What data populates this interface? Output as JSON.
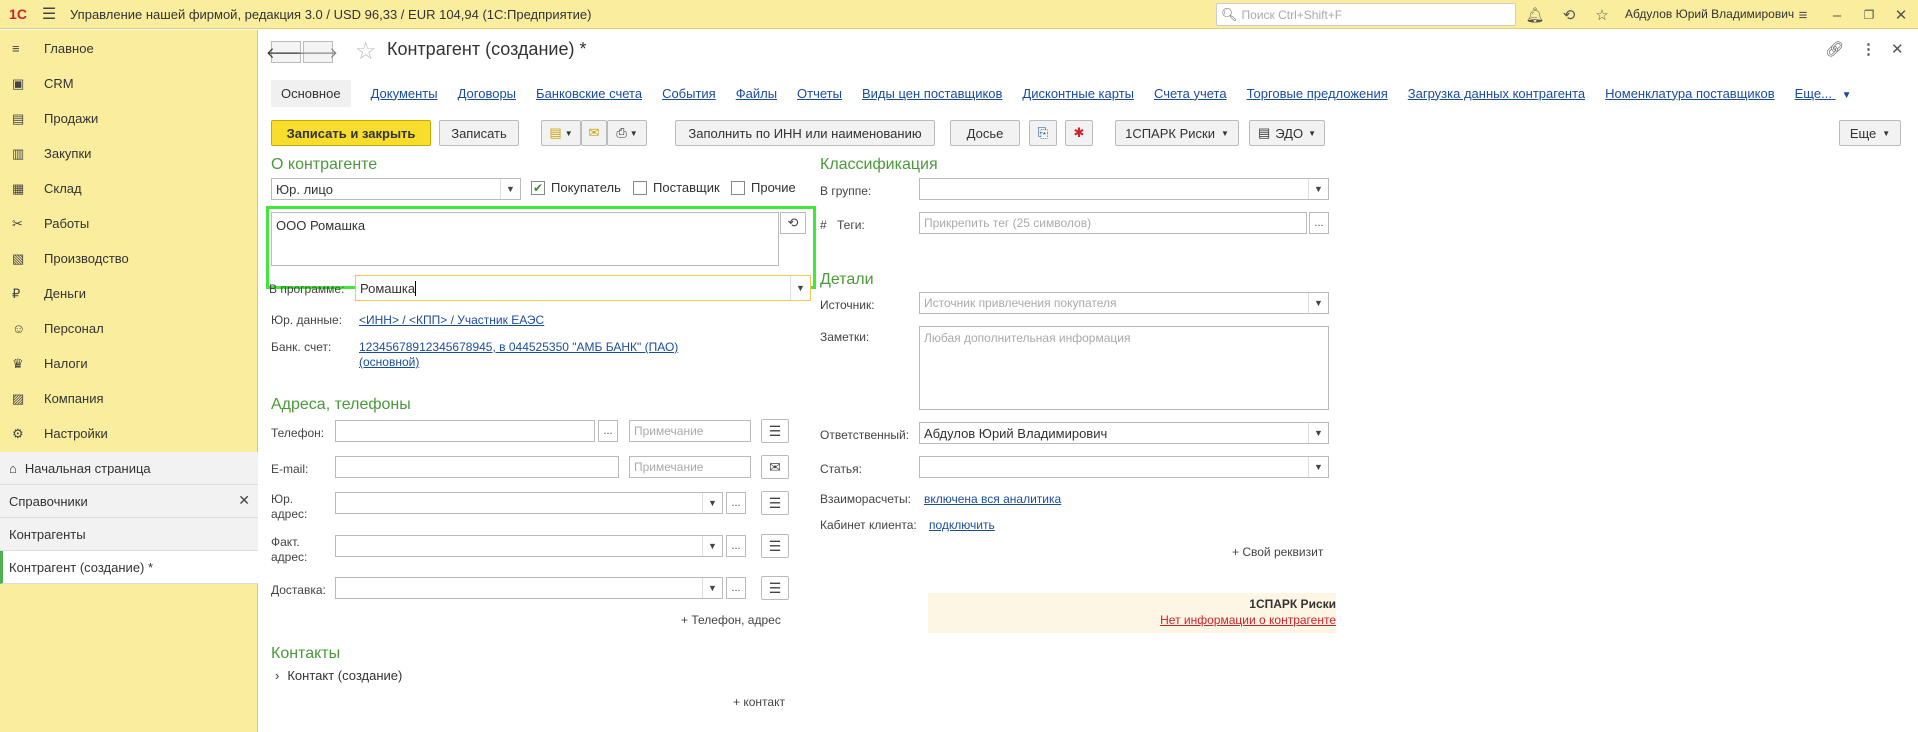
{
  "titlebar": {
    "logo": "1С",
    "title": "Управление нашей фирмой, редакция 3.0 / USD 96,33 / EUR 104,94  (1С:Предприятие)",
    "search_placeholder": "Поиск Ctrl+Shift+F",
    "user": "Абдулов Юрий Владимирович"
  },
  "sidebar": {
    "items": [
      {
        "label": "Главное",
        "icon": "≡"
      },
      {
        "label": "CRM",
        "icon": "▣"
      },
      {
        "label": "Продажи",
        "icon": "▤"
      },
      {
        "label": "Закупки",
        "icon": "▥"
      },
      {
        "label": "Склад",
        "icon": "▦"
      },
      {
        "label": "Работы",
        "icon": "✂"
      },
      {
        "label": "Производство",
        "icon": "▧"
      },
      {
        "label": "Деньги",
        "icon": "₽"
      },
      {
        "label": "Персонал",
        "icon": "☺"
      },
      {
        "label": "Налоги",
        "icon": "♛"
      },
      {
        "label": "Компания",
        "icon": "▨"
      },
      {
        "label": "Настройки",
        "icon": "⚙"
      }
    ],
    "home": "Начальная страница",
    "open": [
      {
        "label": "Справочники"
      },
      {
        "label": "Контрагенты"
      },
      {
        "label": "Контрагент (создание) *"
      }
    ]
  },
  "form": {
    "title": "Контрагент (создание) *",
    "tabs": [
      "Основное",
      "Документы",
      "Договоры",
      "Банковские счета",
      "События",
      "Файлы",
      "Отчеты",
      "Виды цен поставщиков",
      "Дисконтные карты",
      "Счета учета",
      "Торговые предложения",
      "Загрузка данных контрагента",
      "Номенклатура поставщиков",
      "Еще..."
    ],
    "toolbar": {
      "save_close": "Записать и закрыть",
      "save": "Записать",
      "fill_inn": "Заполнить по ИНН или наименованию",
      "dossier": "Досье",
      "spark": "1СПАРК Риски",
      "edo": "ЭДО",
      "more": "Еще"
    },
    "about": {
      "header": "О контрагенте",
      "type_value": "Юр. лицо",
      "buyer": "Покупатель",
      "supplier": "Поставщик",
      "other": "Прочие",
      "name_value": "ООО Ромашка",
      "program_label": "В программе:",
      "program_value": "Ромашка",
      "legal_label": "Юр. данные:",
      "legal_link": "<ИНН> / <КПП> / Участник ЕАЭС",
      "bank_label": "Банк. счет:",
      "bank_link1": "12345678912345678945, в 044525350 \"АМБ БАНК\" (ПАО)",
      "bank_link2": "(основной)"
    },
    "addresses": {
      "header": "Адреса, телефоны",
      "phone_label": "Телефон:",
      "email_label": "E-mail:",
      "note_placeholder": "Примечание",
      "legal_label_1": "Юр.",
      "legal_label_2": "адрес:",
      "fact_label_1": "Факт.",
      "fact_label_2": "адрес:",
      "delivery_label": "Доставка:",
      "add_link": "+ Телефон, адрес"
    },
    "contacts": {
      "header": "Контакты",
      "item": "Контакт (создание)",
      "add": "+ контакт"
    },
    "classification": {
      "header": "Классификация",
      "group_label": "В группе:",
      "tags_hash": "#",
      "tags_label": "Теги:",
      "tags_placeholder": "Прикрепить тег (25 символов)"
    },
    "details": {
      "header": "Детали",
      "source_label": "Источник:",
      "source_placeholder": "Источник привлечения покупателя",
      "notes_label": "Заметки:",
      "notes_placeholder": "Любая дополнительная информация",
      "resp_label": "Ответственный:",
      "resp_value": "Абдулов Юрий Владимирович",
      "article_label": "Статья:",
      "settle_label": "Взаиморасчеты:",
      "settle_link": "включена вся аналитика",
      "cabinet_label": "Кабинет клиента:",
      "cabinet_link": "подключить",
      "own_req": "+ Свой реквизит"
    },
    "spark_panel": {
      "title": "1СПАРК Риски",
      "link": "Нет информации о контрагенте"
    }
  }
}
